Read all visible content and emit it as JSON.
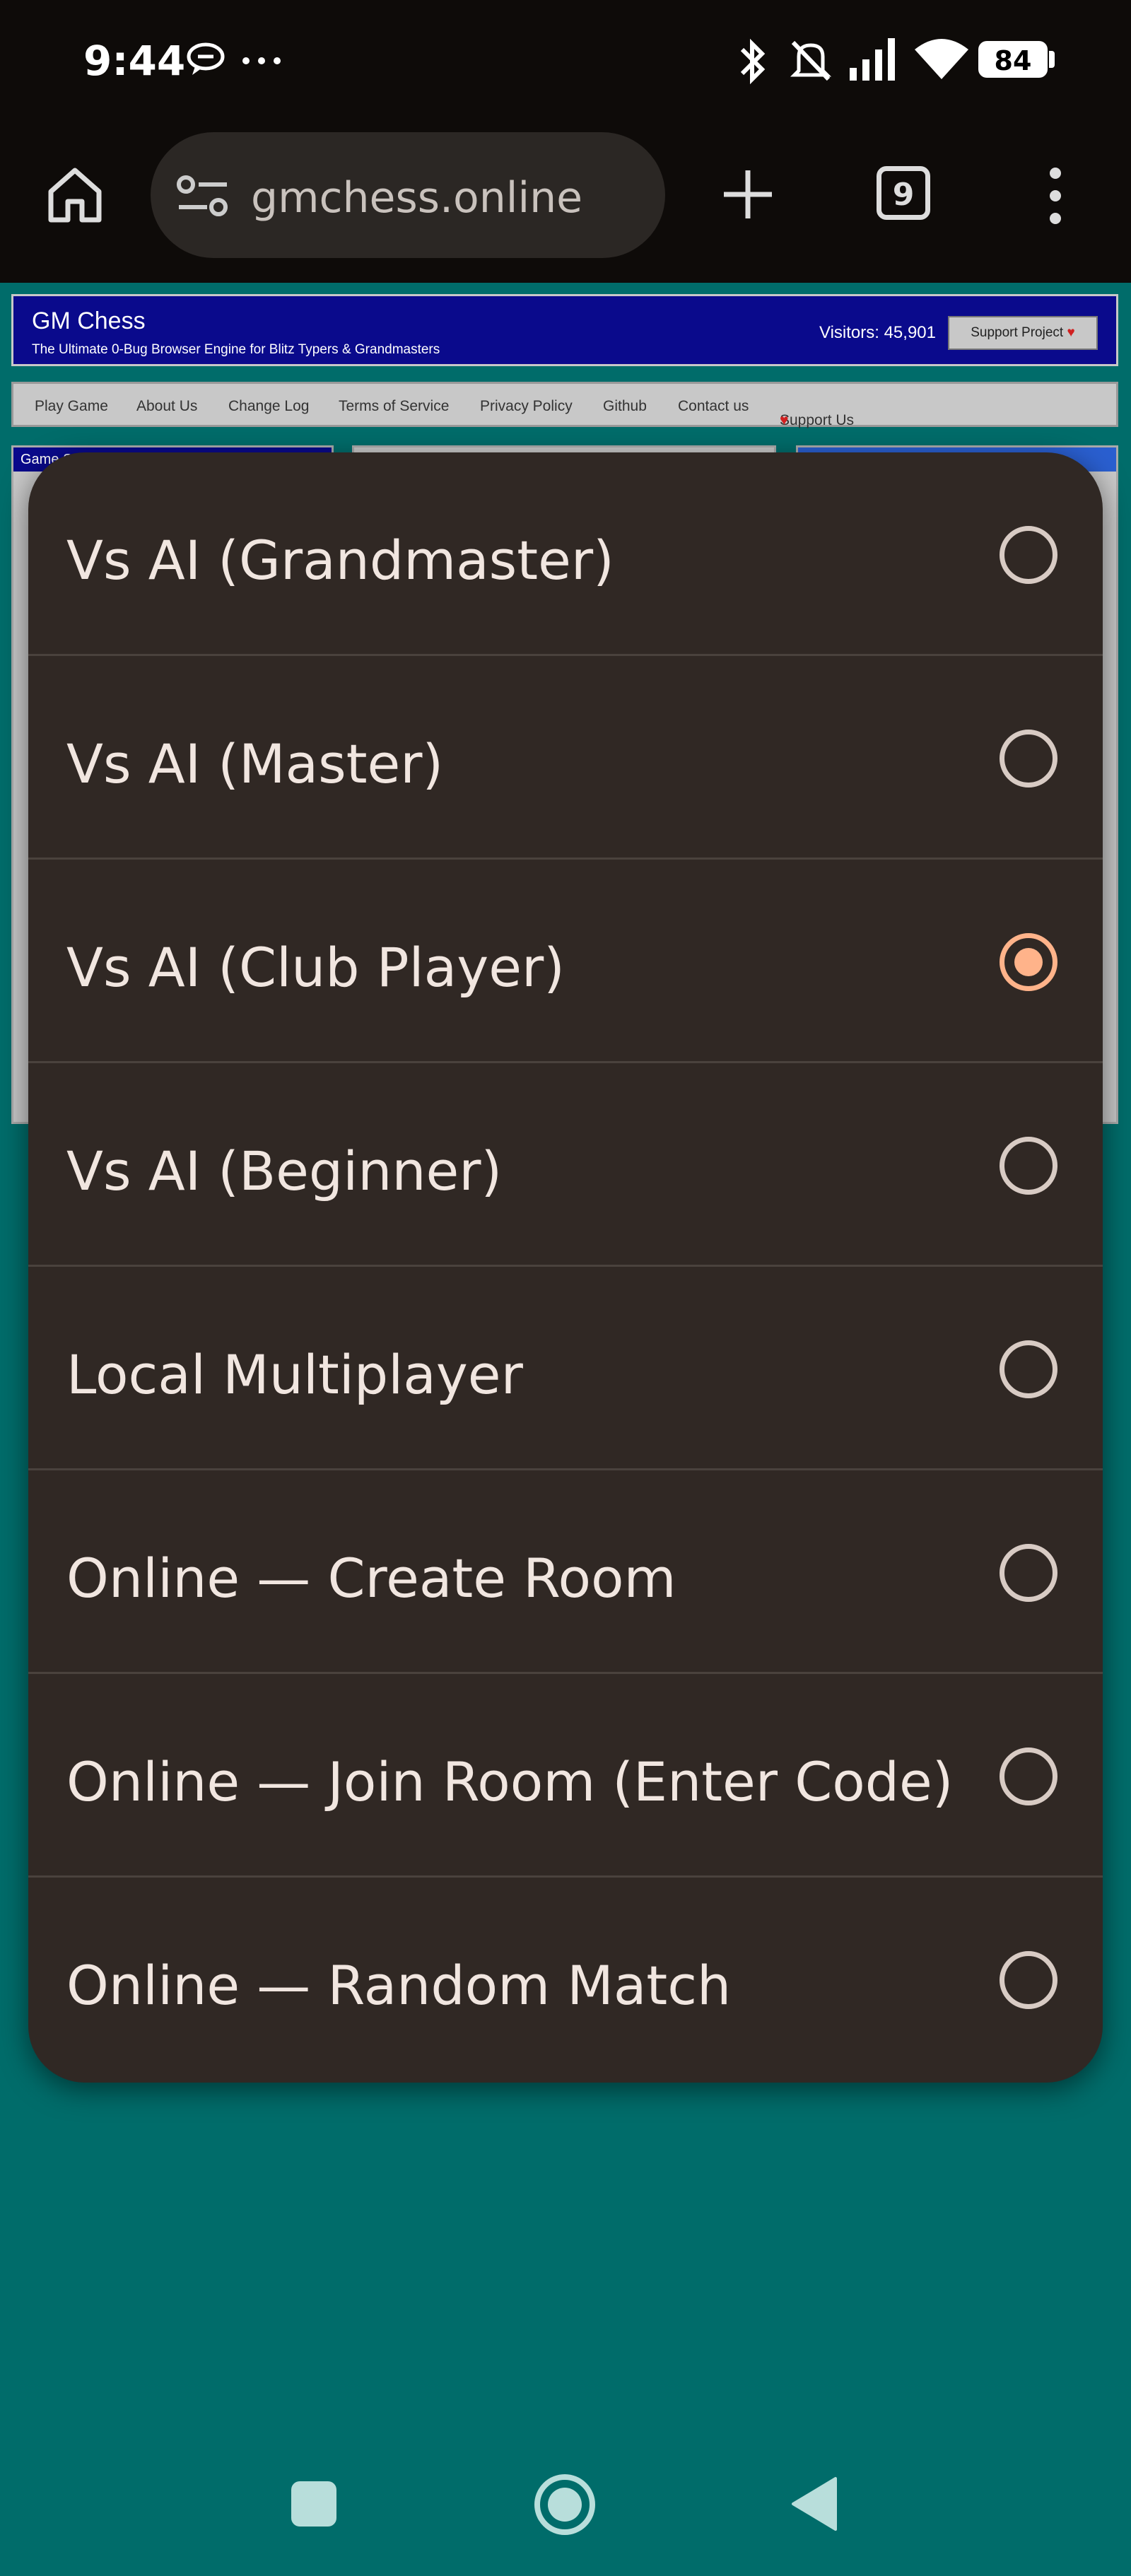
{
  "status_bar": {
    "time": "9:44",
    "battery": "84",
    "icons": [
      "message-bubble-icon",
      "more-dots-icon",
      "bluetooth-icon",
      "mute-icon",
      "signal-icon",
      "wifi-icon",
      "battery-icon"
    ]
  },
  "browser": {
    "url": "gmchess.online",
    "tab_count": "9"
  },
  "site": {
    "title": "GM Chess",
    "tagline": "The Ultimate 0-Bug Browser Engine for Blitz Typers & Grandmasters",
    "visitors": "Visitors: 45,901",
    "support_label": "Support Project",
    "nav": [
      "Play Game",
      "About Us",
      "Change Log",
      "Terms of Service",
      "Privacy Policy",
      "Github",
      "Contact us",
      "Support Us"
    ],
    "panel_head": "Game S"
  },
  "dropdown": {
    "options": [
      {
        "label": "Vs AI (Grandmaster)",
        "selected": false
      },
      {
        "label": "Vs AI (Master)",
        "selected": false
      },
      {
        "label": "Vs AI (Club Player)",
        "selected": true
      },
      {
        "label": "Vs AI (Beginner)",
        "selected": false
      },
      {
        "label": "Local Multiplayer",
        "selected": false
      },
      {
        "label": "Online — Create Room",
        "selected": false
      },
      {
        "label": "Online — Join Room (Enter Code)",
        "selected": false
      },
      {
        "label": "Online — Random Match",
        "selected": false
      }
    ]
  },
  "colors": {
    "accent": "#ffb38a",
    "sheet": "#302824",
    "page_bg": "#006c6a"
  }
}
